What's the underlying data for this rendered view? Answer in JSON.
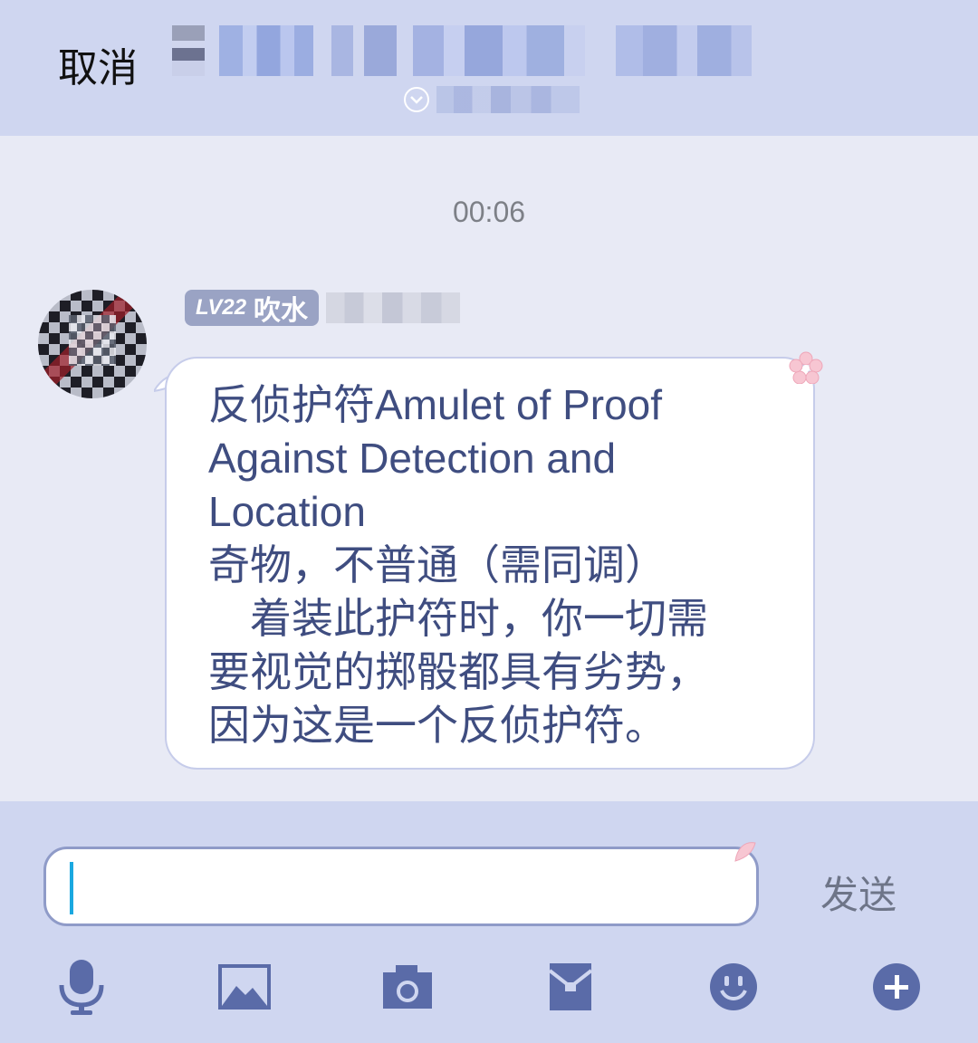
{
  "header": {
    "cancel_label": "取消"
  },
  "chat": {
    "timestamp": "00:06",
    "messages": [
      {
        "level": "LV22",
        "member_title": "吹水",
        "text": "反侦护符Amulet of Proof\nAgainst Detection and\nLocation\n奇物，不普通（需同调）\n　着装此护符时，你一切需\n要视觉的掷骰都具有劣势，\n因为这是一个反侦护符。"
      }
    ]
  },
  "input": {
    "value": "",
    "send_label": "发送"
  },
  "toolbar": {
    "icons": [
      "microphone-icon",
      "image-icon",
      "camera-icon",
      "red-packet-icon",
      "emoji-icon",
      "plus-icon"
    ]
  },
  "colors": {
    "bar_bg": "#cfd6f0",
    "chat_bg": "#e8eaf5",
    "icon": "#5a6ba8",
    "text": "#3f4d80",
    "caret": "#1aa8e0"
  }
}
